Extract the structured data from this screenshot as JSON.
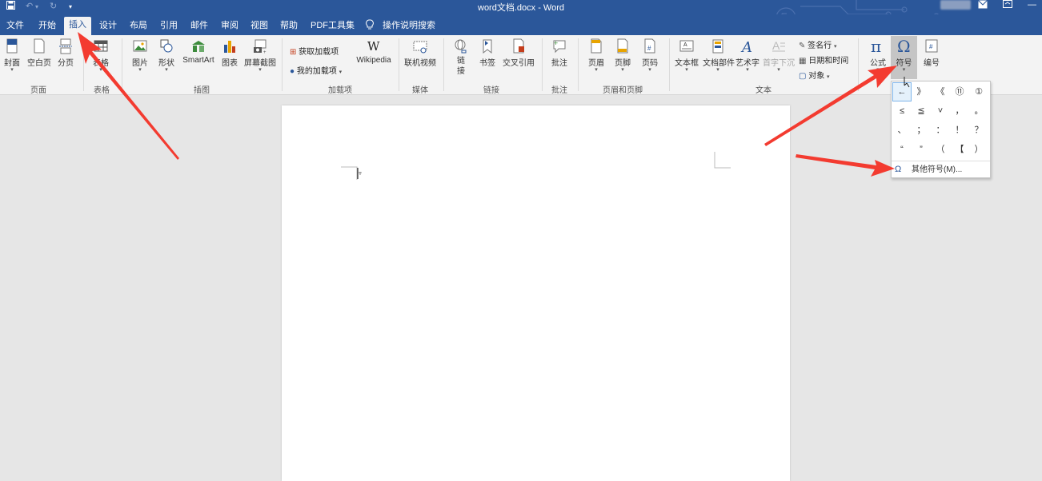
{
  "titlebar": {
    "title": "word文档.docx  -  Word"
  },
  "tabs": [
    "文件",
    "开始",
    "插入",
    "设计",
    "布局",
    "引用",
    "邮件",
    "审阅",
    "视图",
    "帮助",
    "PDF工具集"
  ],
  "tell_me": "操作说明搜索",
  "ribbon": {
    "pages": {
      "cover": "封面",
      "blank": "空白页",
      "break": "分页",
      "group": "页面"
    },
    "tables": {
      "table": "表格",
      "group": "表格"
    },
    "illustrations": {
      "picture": "图片",
      "shapes": "形状",
      "smartart": "SmartArt",
      "chart": "图表",
      "screenshot": "屏幕截图",
      "group": "插图"
    },
    "addins": {
      "get": "获取加载项",
      "my": "我的加载项",
      "wikipedia": "Wikipedia",
      "group": "加载项"
    },
    "media": {
      "video": "联机视频",
      "group": "媒体"
    },
    "links": {
      "link": "链接",
      "bookmark": "书签",
      "crossref": "交叉引用",
      "group": "链接"
    },
    "comments": {
      "comment": "批注",
      "group": "批注"
    },
    "header_footer": {
      "header": "页眉",
      "footer": "页脚",
      "page_number": "页码",
      "group": "页眉和页脚"
    },
    "text": {
      "textbox": "文本框",
      "quickparts": "文档部件",
      "wordart": "艺术字",
      "dropcap": "首字下沉",
      "signature": "签名行",
      "datetime": "日期和时间",
      "object": "对象",
      "group": "文本"
    },
    "symbols": {
      "equation": "公式",
      "symbol": "符号",
      "numbering": "编号"
    }
  },
  "symbol_dropdown": {
    "symbols": [
      "←",
      "》",
      "《",
      "⑪",
      "①",
      "≤",
      "≦",
      "˅",
      "，",
      "。",
      "、",
      "；",
      "：",
      "！",
      "？",
      "“",
      "”",
      "（",
      "【",
      "）"
    ],
    "more": "其他符号(M)..."
  },
  "colors": {
    "accent": "#2b579a",
    "arrow": "#f33b30"
  }
}
